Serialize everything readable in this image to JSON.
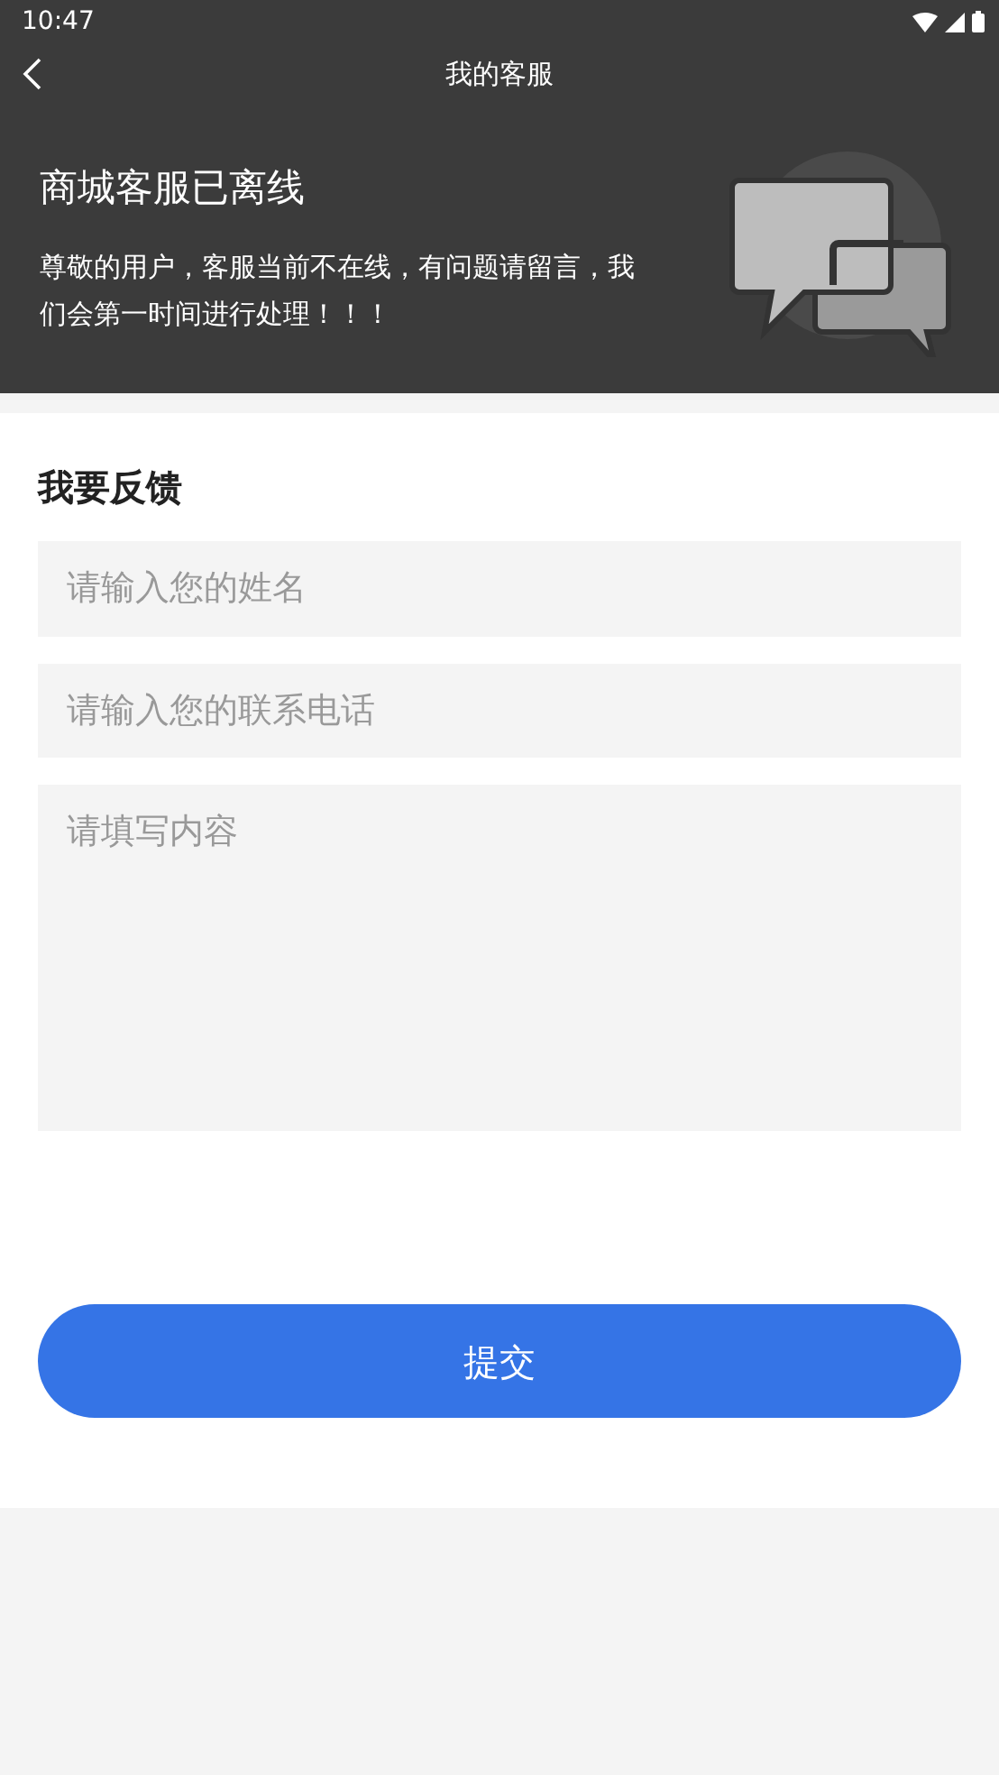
{
  "status_bar": {
    "time": "10:47"
  },
  "header": {
    "title": "我的客服"
  },
  "banner": {
    "title": "商城客服已离线",
    "message": "尊敬的用户，客服当前不在线，有问题请留言，我们会第一时间进行处理！！！"
  },
  "form": {
    "heading": "我要反馈",
    "fields": [
      {
        "kind": "input",
        "placeholder": "请输入您的姓名"
      },
      {
        "kind": "input",
        "placeholder": "请输入您的联系电话"
      },
      {
        "kind": "textarea",
        "placeholder": "请填写内容"
      }
    ],
    "submit": "提交"
  }
}
